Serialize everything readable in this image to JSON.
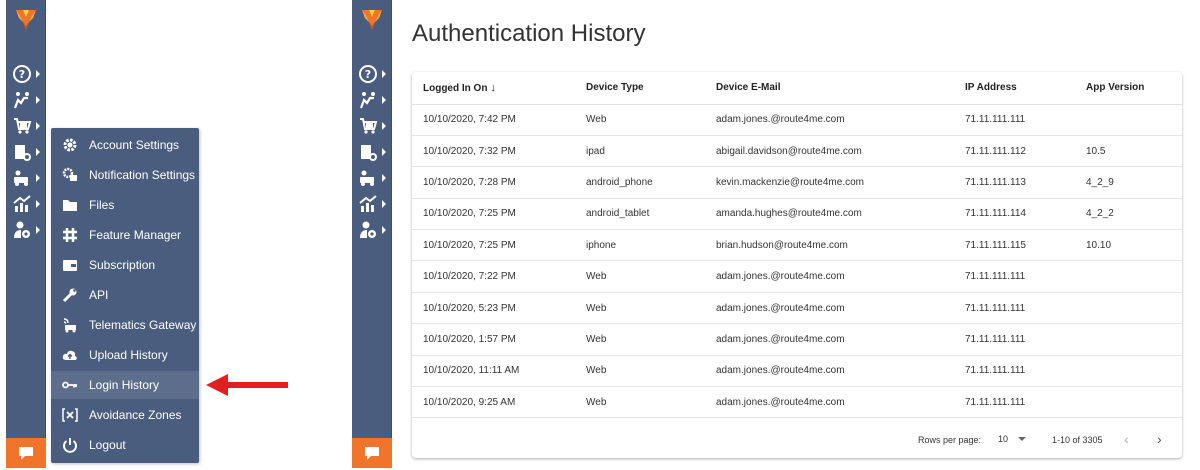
{
  "colors": {
    "sidebar_bg": "#4a5d7e",
    "accent_orange": "#f0752a",
    "arrow_red": "#e02020"
  },
  "sidebar": {
    "icons": [
      "help-icon",
      "routes-icon",
      "orders-icon",
      "tracking-icon",
      "fleet-icon",
      "analytics-icon",
      "user-settings-icon"
    ]
  },
  "flyout": {
    "items": [
      {
        "label": "Account Settings",
        "icon": "gear-icon"
      },
      {
        "label": "Notification Settings",
        "icon": "notification-gear-icon"
      },
      {
        "label": "Files",
        "icon": "folder-icon"
      },
      {
        "label": "Feature Manager",
        "icon": "hash-icon"
      },
      {
        "label": "Subscription",
        "icon": "wallet-icon"
      },
      {
        "label": "API",
        "icon": "wrench-icon"
      },
      {
        "label": "Telematics Gateway",
        "icon": "satellite-icon"
      },
      {
        "label": "Upload History",
        "icon": "cloud-upload-icon"
      },
      {
        "label": "Login History",
        "icon": "key-icon"
      },
      {
        "label": "Avoidance Zones",
        "icon": "zone-x-icon"
      },
      {
        "label": "Logout",
        "icon": "power-icon"
      }
    ],
    "active": "Login History"
  },
  "main": {
    "title": "Authentication History",
    "columns": [
      "Logged In On",
      "Device Type",
      "Device E-Mail",
      "IP Address",
      "App Version"
    ],
    "sort_indicator": "↓",
    "rows": [
      [
        "10/10/2020, 7:42 PM",
        "Web",
        "adam.jones.@route4me.com",
        "71.11.111.111",
        ""
      ],
      [
        "10/10/2020, 7:32 PM",
        "ipad",
        "abigail.davidson@route4me.com",
        "71.11.111.112",
        "10.5"
      ],
      [
        "10/10/2020, 7:28 PM",
        "android_phone",
        "kevin.mackenzie@route4me.com",
        "71.11.111.113",
        "4_2_9"
      ],
      [
        "10/10/2020, 7:25 PM",
        "android_tablet",
        "amanda.hughes@route4me.com",
        "71.11.111.114",
        "4_2_2"
      ],
      [
        "10/10/2020, 7:25 PM",
        "iphone",
        "brian.hudson@route4me.com",
        "71.11.111.115",
        "10.10"
      ],
      [
        "10/10/2020, 7:22 PM",
        "Web",
        "adam.jones.@route4me.com",
        "71.11.111.111",
        ""
      ],
      [
        "10/10/2020, 5:23 PM",
        "Web",
        "adam.jones.@route4me.com",
        "71.11.111.111",
        ""
      ],
      [
        "10/10/2020, 1:57 PM",
        "Web",
        "adam.jones.@route4me.com",
        "71.11.111.111",
        ""
      ],
      [
        "10/10/2020, 11:11 AM",
        "Web",
        "adam.jones.@route4me.com",
        "71.11.111.111",
        ""
      ],
      [
        "10/10/2020, 9:25 AM",
        "Web",
        "adam.jones.@route4me.com",
        "71.11.111.111",
        ""
      ]
    ],
    "footer": {
      "rows_per_page_label": "Rows per page:",
      "rows_per_page_value": "10",
      "range_text": "1-10 of 3305",
      "prev_glyph": "‹",
      "next_glyph": "›"
    }
  }
}
